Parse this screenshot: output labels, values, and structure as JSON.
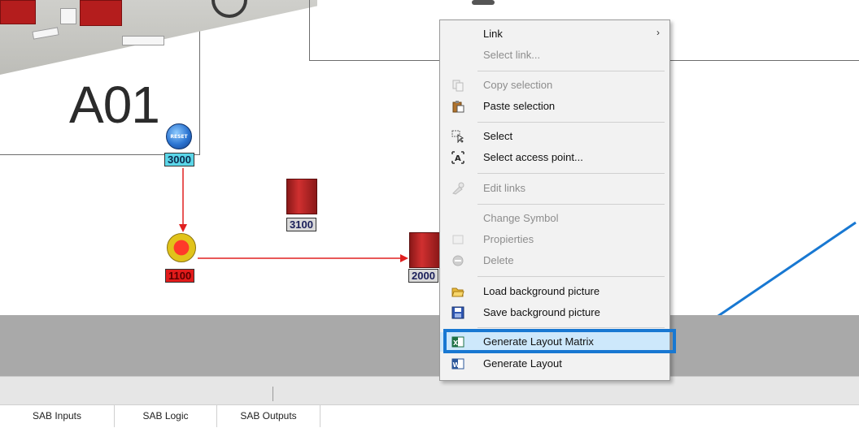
{
  "diagram": {
    "area_label": "A01",
    "nodes": [
      {
        "id": "3000",
        "kind": "reset",
        "icon_text": "RESET"
      },
      {
        "id": "3100",
        "kind": "relay"
      },
      {
        "id": "1100",
        "kind": "estop"
      },
      {
        "id": "2000",
        "kind": "relay"
      }
    ]
  },
  "context_menu": {
    "items": [
      {
        "label": "Link",
        "enabled": true,
        "submenu": true
      },
      {
        "label": "Select link...",
        "enabled": false
      },
      {
        "label": "Copy selection",
        "enabled": false
      },
      {
        "label": "Paste selection",
        "enabled": true
      },
      {
        "label": "Select",
        "enabled": true
      },
      {
        "label": "Select access point...",
        "enabled": true
      },
      {
        "label": "Edit links",
        "enabled": false
      },
      {
        "label": "Change Symbol",
        "enabled": false
      },
      {
        "label": "Propierties",
        "enabled": false
      },
      {
        "label": "Delete",
        "enabled": false
      },
      {
        "label": "Load background picture",
        "enabled": true
      },
      {
        "label": "Save background picture",
        "enabled": true
      },
      {
        "label": "Generate Layout Matrix",
        "enabled": true,
        "highlighted": true
      },
      {
        "label": "Generate Layout",
        "enabled": true
      }
    ],
    "submenu_arrow": "›"
  },
  "tabs": [
    "SAB Inputs",
    "SAB Logic",
    "SAB Outputs"
  ],
  "colors": {
    "link_line": "#e02020",
    "callout": "#1878d2",
    "menu_highlight": "#cde8fb"
  }
}
